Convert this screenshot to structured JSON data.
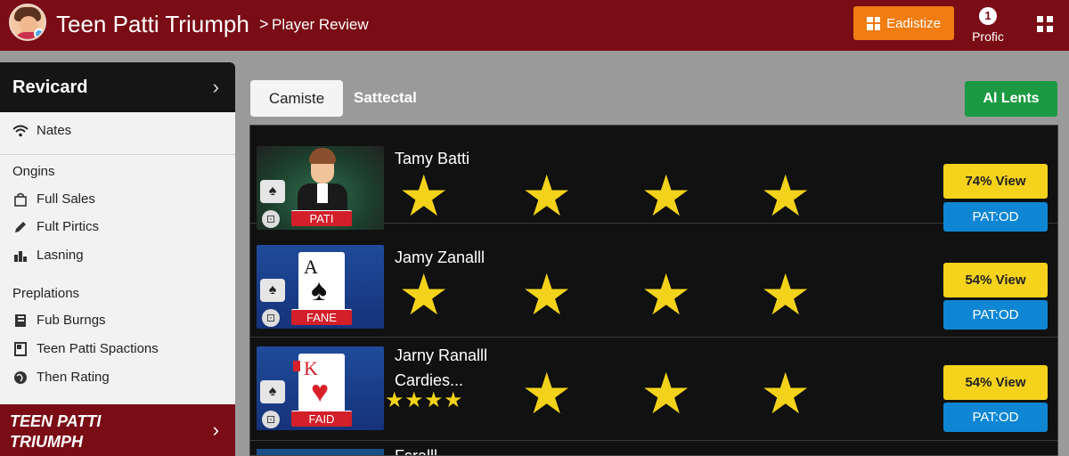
{
  "header": {
    "app_title": "Teen Patti Triumph",
    "breadcrumb_sep": ">",
    "breadcrumb": "Player Review",
    "action_button": "Eadistize",
    "profile_badge": "1",
    "profile_label": "Profic",
    "colors": {
      "bar": "#7a0c15",
      "action": "#f07c12"
    }
  },
  "sidebar": {
    "title": "Revicard",
    "top_item": {
      "label": "Nates",
      "icon": "wifi-icon"
    },
    "section1": "Ongins",
    "section1_items": [
      {
        "label": "Full Sales",
        "icon": "bag-icon"
      },
      {
        "label": "Fult Pirtics",
        "icon": "pencil-icon"
      },
      {
        "label": "Lasning",
        "icon": "chart-icon"
      }
    ],
    "section2": "Preplations",
    "section2_items": [
      {
        "label": "Fub Burngs",
        "icon": "book-icon"
      },
      {
        "label": "Teen Patti Spactions",
        "icon": "flag-icon"
      },
      {
        "label": "Then Rating",
        "icon": "globe-icon"
      }
    ],
    "footer": "TEEN PATTI\nTRIUMPH"
  },
  "tabs": {
    "active": "Camiste",
    "inactive": "Sattectal",
    "right_button": "Al Lents"
  },
  "rows": [
    {
      "name": "Tamy Batti",
      "subtitle": "",
      "thumb_label": "PATI",
      "thumb_type": "dealer",
      "stars": 4,
      "view_label": "74% View",
      "status_label": "PAT:OD"
    },
    {
      "name": "Jamy Zanalll",
      "subtitle": "",
      "thumb_label": "FANE",
      "thumb_type": "card",
      "card_rank": "A",
      "card_suit": "♠",
      "stars": 4,
      "view_label": "54% View",
      "status_label": "PAT:OD"
    },
    {
      "name": "Jarny Ranalll",
      "subtitle": "Cardies...",
      "thumb_label": "FAID",
      "thumb_type": "card",
      "card_rank": "K",
      "card_suit": "♥",
      "stars": 3,
      "mini_stars": 4,
      "view_label": "54% View",
      "status_label": "PAT:OD"
    },
    {
      "name": "Fsralll",
      "partial": true
    }
  ],
  "thumb_suit": "♠",
  "star_glyph": "★"
}
